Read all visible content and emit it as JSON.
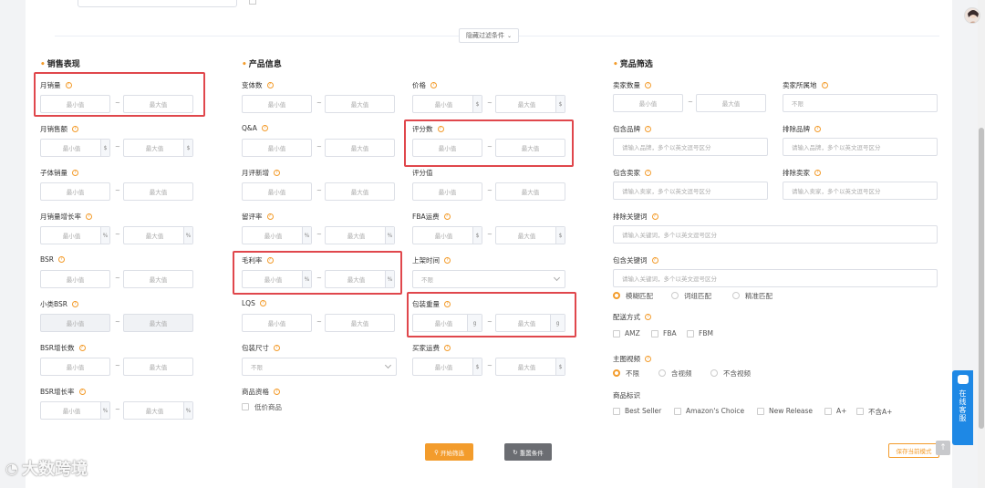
{
  "toggle_filter": "隐藏过滤条件",
  "sections": {
    "sales": "销售表现",
    "product": "产品信息",
    "competitor": "竞品筛选"
  },
  "placeholders": {
    "min": "最小值",
    "max": "最大值",
    "any": "不限",
    "brand_include": "请输入品牌，多个以英文逗号区分",
    "brand_exclude": "请输入品牌，多个以英文逗号区分",
    "seller_include": "请输入卖家，多个以英文逗号区分",
    "seller_exclude": "请输入卖家，多个以英文逗号区分",
    "keyword_exclude": "请输入关键词，多个以英文逗号区分",
    "keyword_include": "请输入关键词，多个以英文逗号区分"
  },
  "units": {
    "dollar": "$",
    "percent": "%",
    "gram": "g"
  },
  "sales_fields": [
    "月销量",
    "月销售额",
    "子体销量",
    "月销量增长率",
    "BSR",
    "小类BSR",
    "BSR增长数",
    "BSR增长率"
  ],
  "product_fields_left": [
    "变体数",
    "Q&A",
    "月评新增",
    "留评率",
    "毛利率",
    "LQS",
    "包装尺寸",
    "商品资格"
  ],
  "product_fields_right": [
    "价格",
    "评分数",
    "评分值",
    "FBA运费",
    "上架时间",
    "包装重量",
    "买家运费"
  ],
  "low_price_label": "低价商品",
  "competitor_labels": {
    "seller_count": "卖家数量",
    "seller_location": "卖家所属地",
    "brand_include": "包含品牌",
    "brand_exclude": "排除品牌",
    "seller_include": "包含卖家",
    "seller_exclude": "排除卖家",
    "keyword_exclude": "排除关键词",
    "keyword_include": "包含关键词",
    "delivery": "配送方式",
    "main_video": "主图视频",
    "product_tag": "商品标识"
  },
  "match_options": [
    "模糊匹配",
    "词组匹配",
    "精准匹配"
  ],
  "delivery_options": [
    "AMZ",
    "FBA",
    "FBM"
  ],
  "video_options": [
    "不限",
    "含视频",
    "不含视频"
  ],
  "tag_options": [
    "Best Seller",
    "Amazon's Choice",
    "New Release",
    "A+",
    "不含A+"
  ],
  "buttons": {
    "start": "开始筛选",
    "reset": "重置条件",
    "save": "保存当前模式"
  },
  "customer_service": "在线客服",
  "watermark": "大数跨境",
  "colors": {
    "accent": "#f39c2c",
    "highlight": "#e0474c",
    "service": "#1e88e5"
  }
}
